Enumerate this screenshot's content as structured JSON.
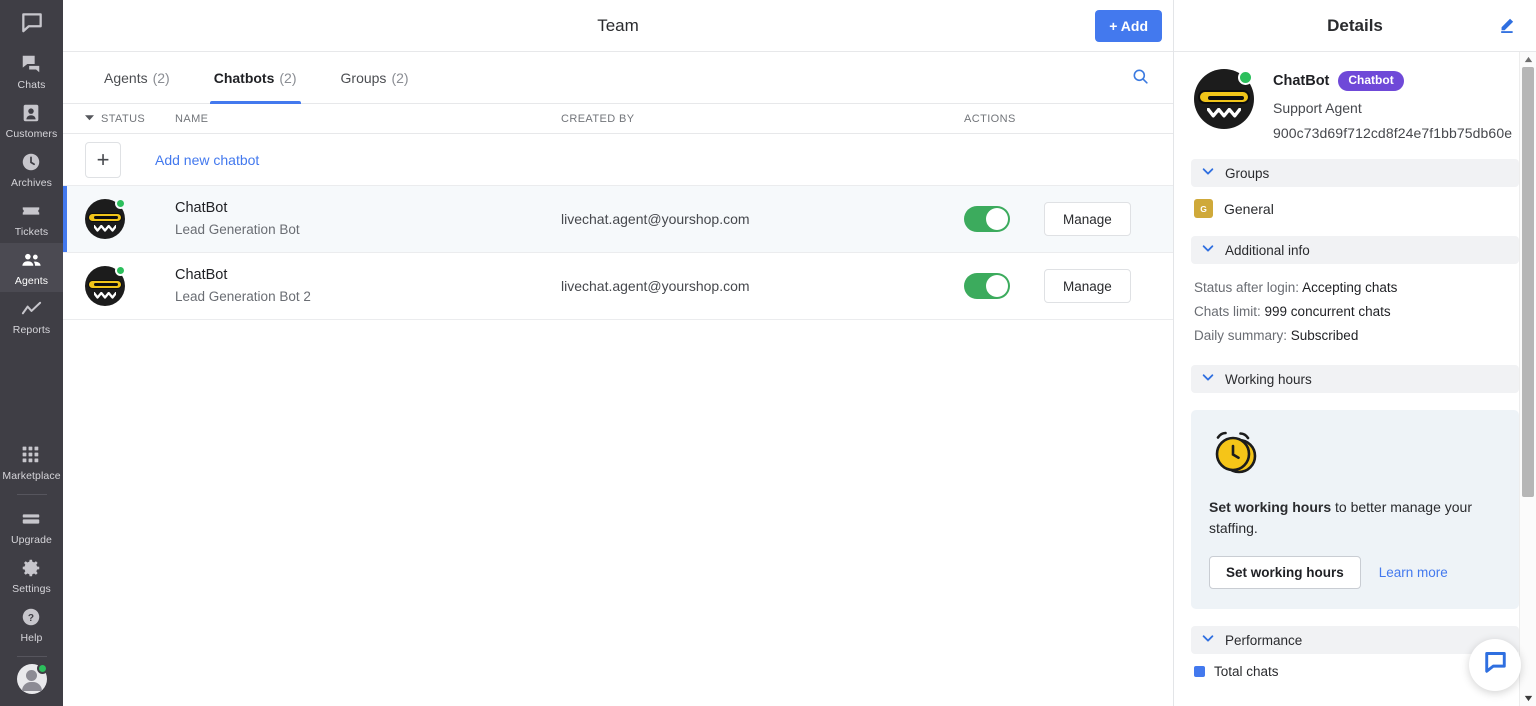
{
  "rail": {
    "brand_icon": "speech-bubble-logo",
    "items": [
      {
        "label": "Chats",
        "icon": "chats-icon",
        "active": false
      },
      {
        "label": "Customers",
        "icon": "customers-icon",
        "active": false
      },
      {
        "label": "Archives",
        "icon": "archives-clock-icon",
        "active": false
      },
      {
        "label": "Tickets",
        "icon": "tickets-icon",
        "active": false
      },
      {
        "label": "Agents",
        "icon": "agents-icon",
        "active": true
      },
      {
        "label": "Reports",
        "icon": "reports-chart-icon",
        "active": false
      }
    ],
    "bottom_items": [
      {
        "label": "Marketplace",
        "icon": "marketplace-grid-icon"
      },
      {
        "label": "Upgrade",
        "icon": "upgrade-card-icon"
      },
      {
        "label": "Settings",
        "icon": "settings-gear-icon"
      },
      {
        "label": "Help",
        "icon": "help-question-icon"
      }
    ],
    "avatar_status": "online"
  },
  "header": {
    "title": "Team",
    "add_label": "+ Add"
  },
  "tabs": [
    {
      "label": "Agents",
      "count": "(2)",
      "active": false
    },
    {
      "label": "Chatbots",
      "count": "(2)",
      "active": true
    },
    {
      "label": "Groups",
      "count": "(2)",
      "active": false
    }
  ],
  "search": {
    "icon": "search-icon"
  },
  "table": {
    "columns": {
      "status": "STATUS",
      "name": "NAME",
      "created_by": "CREATED BY",
      "actions": "ACTIONS"
    },
    "add_row": {
      "plus": "+",
      "label": "Add new chatbot"
    },
    "rows": [
      {
        "name": "ChatBot",
        "subtitle": "Lead Generation Bot",
        "created_by": "livechat.agent@yourshop.com",
        "enabled": true,
        "manage_label": "Manage",
        "selected": true,
        "status": "online"
      },
      {
        "name": "ChatBot",
        "subtitle": "Lead Generation Bot 2",
        "created_by": "livechat.agent@yourshop.com",
        "enabled": true,
        "manage_label": "Manage",
        "selected": false,
        "status": "online"
      }
    ]
  },
  "details": {
    "title": "Details",
    "edit_icon": "edit-pencil-icon",
    "profile": {
      "name": "ChatBot",
      "badge": "Chatbot",
      "role": "Support Agent",
      "id": "900c73d69f712cd8f24e7f1bb75db60e",
      "status": "online"
    },
    "groups_section": {
      "title": "Groups",
      "items": [
        {
          "initial": "G",
          "name": "General"
        }
      ]
    },
    "additional_info": {
      "title": "Additional info",
      "rows": [
        {
          "key": "Status after login:",
          "value": "Accepting chats"
        },
        {
          "key": "Chats limit:",
          "value": "999 concurrent chats"
        },
        {
          "key": "Daily summary:",
          "value": "Subscribed"
        }
      ]
    },
    "working_hours": {
      "title": "Working hours",
      "icon": "alarm-clock-icon",
      "text_bold": "Set working hours",
      "text_rest": " to better manage your staffing.",
      "button_label": "Set working hours",
      "link_label": "Learn more"
    },
    "performance": {
      "title": "Performance",
      "partial_row_label": "Total chats"
    }
  },
  "chat_widget": {
    "icon": "chat-bubble-icon"
  },
  "colors": {
    "accent_blue": "#4379ee",
    "rail_bg": "#3f3e45",
    "toggle_green": "#3cab5d",
    "badge_purple": "#6f49d8",
    "group_gold": "#cfa93a",
    "selected_row": "#f6f9fb",
    "card_bg": "#eef3f7"
  }
}
